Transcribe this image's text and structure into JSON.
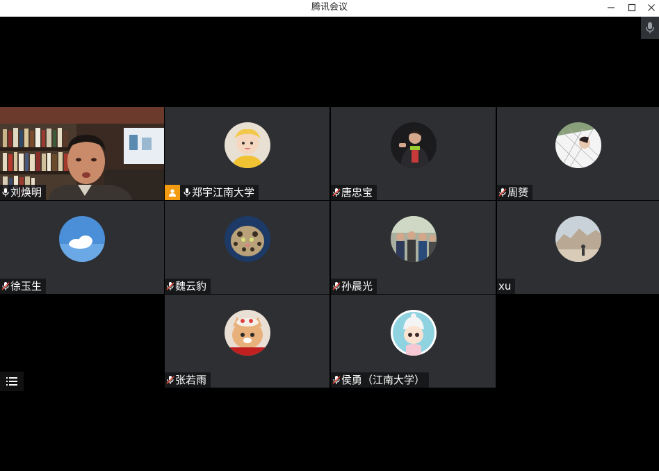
{
  "window": {
    "title": "腾讯会议"
  },
  "participants": [
    {
      "name": "刘焕明",
      "mic": "on"
    },
    {
      "name": "郑宇江南大学",
      "mic": "on"
    },
    {
      "name": "唐忠宝",
      "mic": "muted"
    },
    {
      "name": "周赟",
      "mic": "muted"
    },
    {
      "name": "徐玉生",
      "mic": "muted"
    },
    {
      "name": "魏云豹",
      "mic": "muted"
    },
    {
      "name": "孙晨光",
      "mic": "muted"
    },
    {
      "name": "xu",
      "mic": "none"
    },
    {
      "name": "张若雨",
      "mic": "muted"
    },
    {
      "name": "侯勇（江南大学）",
      "mic": "muted"
    }
  ],
  "colors": {
    "tile": "#2d2f33",
    "active_border": "#2ecc71",
    "host_badge": "#f39c12",
    "muted_mic": "#e74c3c"
  },
  "icons": {
    "minimize": "minimize-icon",
    "maximize": "maximize-icon",
    "close": "close-icon",
    "mic": "microphone-icon",
    "list": "list-icon",
    "host": "person-icon"
  }
}
